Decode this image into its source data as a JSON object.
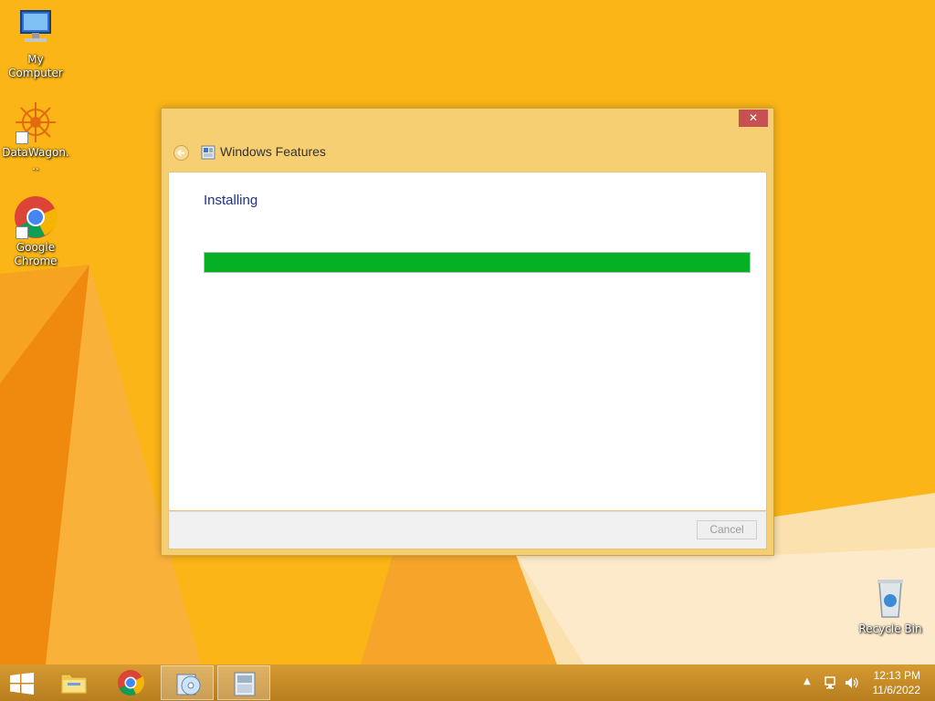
{
  "desktop": {
    "icons": [
      {
        "label": "My Computer",
        "icon": "computer-icon"
      },
      {
        "label": "DataWagon...",
        "icon": "datawagon-icon"
      },
      {
        "label": "Google Chrome",
        "icon": "chrome-icon"
      },
      {
        "label": "Recycle Bin",
        "icon": "recycle-bin-icon"
      }
    ]
  },
  "dialog": {
    "title": "Windows Features",
    "close_label": "✕",
    "status": "Installing",
    "progress": 1.0,
    "cancel_label": "Cancel",
    "progress_color": "#06b025"
  },
  "taskbar": {
    "items": [
      {
        "icon": "start-icon"
      },
      {
        "icon": "file-explorer-icon"
      },
      {
        "icon": "chrome-icon"
      },
      {
        "icon": "disc-setup-icon"
      },
      {
        "icon": "windows-features-icon"
      }
    ],
    "tray": {
      "time": "12:13 PM",
      "date": "11/6/2022"
    }
  },
  "colors": {
    "desktop_bg": "#fbb516",
    "dialog_frame": "#f5cf72",
    "taskbar": "#c88e2a",
    "close_button": "#c75050"
  }
}
